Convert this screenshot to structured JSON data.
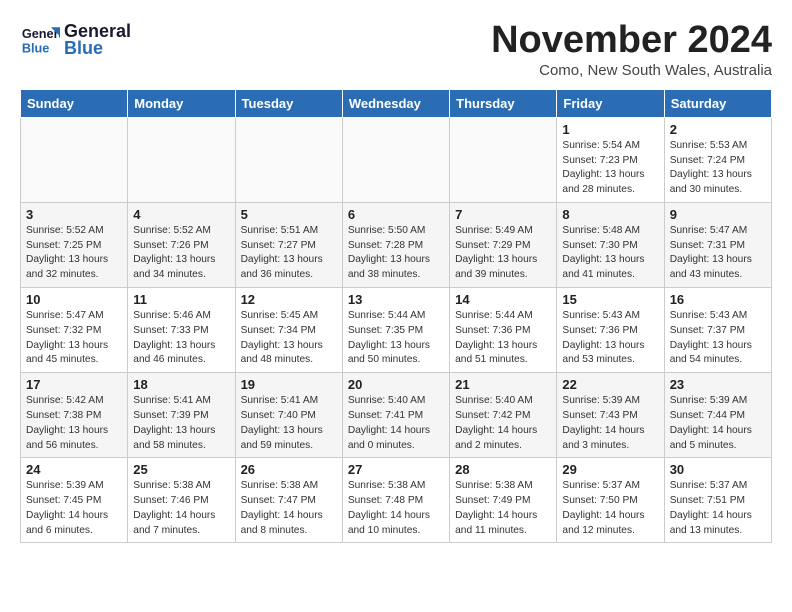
{
  "header": {
    "logo_line1": "General",
    "logo_line2": "Blue",
    "month_title": "November 2024",
    "subtitle": "Como, New South Wales, Australia"
  },
  "weekdays": [
    "Sunday",
    "Monday",
    "Tuesday",
    "Wednesday",
    "Thursday",
    "Friday",
    "Saturday"
  ],
  "weeks": [
    [
      {
        "day": "",
        "info": ""
      },
      {
        "day": "",
        "info": ""
      },
      {
        "day": "",
        "info": ""
      },
      {
        "day": "",
        "info": ""
      },
      {
        "day": "",
        "info": ""
      },
      {
        "day": "1",
        "info": "Sunrise: 5:54 AM\nSunset: 7:23 PM\nDaylight: 13 hours\nand 28 minutes."
      },
      {
        "day": "2",
        "info": "Sunrise: 5:53 AM\nSunset: 7:24 PM\nDaylight: 13 hours\nand 30 minutes."
      }
    ],
    [
      {
        "day": "3",
        "info": "Sunrise: 5:52 AM\nSunset: 7:25 PM\nDaylight: 13 hours\nand 32 minutes."
      },
      {
        "day": "4",
        "info": "Sunrise: 5:52 AM\nSunset: 7:26 PM\nDaylight: 13 hours\nand 34 minutes."
      },
      {
        "day": "5",
        "info": "Sunrise: 5:51 AM\nSunset: 7:27 PM\nDaylight: 13 hours\nand 36 minutes."
      },
      {
        "day": "6",
        "info": "Sunrise: 5:50 AM\nSunset: 7:28 PM\nDaylight: 13 hours\nand 38 minutes."
      },
      {
        "day": "7",
        "info": "Sunrise: 5:49 AM\nSunset: 7:29 PM\nDaylight: 13 hours\nand 39 minutes."
      },
      {
        "day": "8",
        "info": "Sunrise: 5:48 AM\nSunset: 7:30 PM\nDaylight: 13 hours\nand 41 minutes."
      },
      {
        "day": "9",
        "info": "Sunrise: 5:47 AM\nSunset: 7:31 PM\nDaylight: 13 hours\nand 43 minutes."
      }
    ],
    [
      {
        "day": "10",
        "info": "Sunrise: 5:47 AM\nSunset: 7:32 PM\nDaylight: 13 hours\nand 45 minutes."
      },
      {
        "day": "11",
        "info": "Sunrise: 5:46 AM\nSunset: 7:33 PM\nDaylight: 13 hours\nand 46 minutes."
      },
      {
        "day": "12",
        "info": "Sunrise: 5:45 AM\nSunset: 7:34 PM\nDaylight: 13 hours\nand 48 minutes."
      },
      {
        "day": "13",
        "info": "Sunrise: 5:44 AM\nSunset: 7:35 PM\nDaylight: 13 hours\nand 50 minutes."
      },
      {
        "day": "14",
        "info": "Sunrise: 5:44 AM\nSunset: 7:36 PM\nDaylight: 13 hours\nand 51 minutes."
      },
      {
        "day": "15",
        "info": "Sunrise: 5:43 AM\nSunset: 7:36 PM\nDaylight: 13 hours\nand 53 minutes."
      },
      {
        "day": "16",
        "info": "Sunrise: 5:43 AM\nSunset: 7:37 PM\nDaylight: 13 hours\nand 54 minutes."
      }
    ],
    [
      {
        "day": "17",
        "info": "Sunrise: 5:42 AM\nSunset: 7:38 PM\nDaylight: 13 hours\nand 56 minutes."
      },
      {
        "day": "18",
        "info": "Sunrise: 5:41 AM\nSunset: 7:39 PM\nDaylight: 13 hours\nand 58 minutes."
      },
      {
        "day": "19",
        "info": "Sunrise: 5:41 AM\nSunset: 7:40 PM\nDaylight: 13 hours\nand 59 minutes."
      },
      {
        "day": "20",
        "info": "Sunrise: 5:40 AM\nSunset: 7:41 PM\nDaylight: 14 hours\nand 0 minutes."
      },
      {
        "day": "21",
        "info": "Sunrise: 5:40 AM\nSunset: 7:42 PM\nDaylight: 14 hours\nand 2 minutes."
      },
      {
        "day": "22",
        "info": "Sunrise: 5:39 AM\nSunset: 7:43 PM\nDaylight: 14 hours\nand 3 minutes."
      },
      {
        "day": "23",
        "info": "Sunrise: 5:39 AM\nSunset: 7:44 PM\nDaylight: 14 hours\nand 5 minutes."
      }
    ],
    [
      {
        "day": "24",
        "info": "Sunrise: 5:39 AM\nSunset: 7:45 PM\nDaylight: 14 hours\nand 6 minutes."
      },
      {
        "day": "25",
        "info": "Sunrise: 5:38 AM\nSunset: 7:46 PM\nDaylight: 14 hours\nand 7 minutes."
      },
      {
        "day": "26",
        "info": "Sunrise: 5:38 AM\nSunset: 7:47 PM\nDaylight: 14 hours\nand 8 minutes."
      },
      {
        "day": "27",
        "info": "Sunrise: 5:38 AM\nSunset: 7:48 PM\nDaylight: 14 hours\nand 10 minutes."
      },
      {
        "day": "28",
        "info": "Sunrise: 5:38 AM\nSunset: 7:49 PM\nDaylight: 14 hours\nand 11 minutes."
      },
      {
        "day": "29",
        "info": "Sunrise: 5:37 AM\nSunset: 7:50 PM\nDaylight: 14 hours\nand 12 minutes."
      },
      {
        "day": "30",
        "info": "Sunrise: 5:37 AM\nSunset: 7:51 PM\nDaylight: 14 hours\nand 13 minutes."
      }
    ]
  ]
}
